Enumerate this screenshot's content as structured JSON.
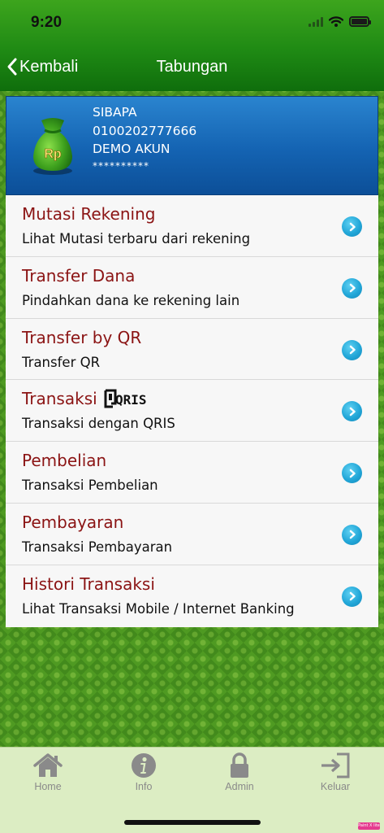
{
  "status_bar": {
    "time": "9:20"
  },
  "nav": {
    "back_label": "Kembali",
    "title": "Tabungan"
  },
  "account": {
    "icon_text": "Rp",
    "name": "SIBAPA",
    "number": "0100202777666",
    "type": "DEMO AKUN",
    "balance_masked": "**********"
  },
  "menu": [
    {
      "title": "Mutasi Rekening",
      "subtitle": "Lihat Mutasi terbaru dari rekening"
    },
    {
      "title": "Transfer Dana",
      "subtitle": "Pindahkan dana ke rekening lain"
    },
    {
      "title": "Transfer by QR",
      "subtitle": "Transfer QR"
    },
    {
      "title": "Transaksi",
      "title_logo": "QRIS",
      "subtitle": "Transaksi dengan QRIS"
    },
    {
      "title": "Pembelian",
      "subtitle": "Transaksi Pembelian"
    },
    {
      "title": "Pembayaran",
      "subtitle": "Transaksi Pembayaran"
    },
    {
      "title": "Histori Transaksi",
      "subtitle": "Lihat Transaksi Mobile / Internet Banking"
    }
  ],
  "tabs": [
    {
      "label": "Home",
      "icon": "home-icon"
    },
    {
      "label": "Info",
      "icon": "info-icon"
    },
    {
      "label": "Admin",
      "icon": "lock-icon"
    },
    {
      "label": "Keluar",
      "icon": "logout-icon"
    }
  ],
  "badge_text": "Paint X lite",
  "colors": {
    "header_green": "#1f8a14",
    "card_blue": "#1463b2",
    "title_red": "#8b1414",
    "chevron_cyan": "#22a7d8",
    "tabbar_bg": "#dcedc3",
    "tab_icon_gray": "#8a8a8a"
  }
}
